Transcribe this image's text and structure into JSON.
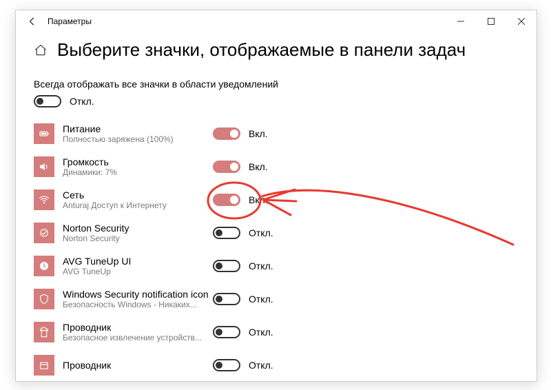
{
  "window": {
    "title": "Параметры"
  },
  "page": {
    "title": "Выберите значки, отображаемые в панели задач",
    "subline": "Всегда отображать все значки в области уведомлений"
  },
  "master_toggle": {
    "on": false,
    "state_label": "Откл."
  },
  "labels": {
    "on": "Вкл.",
    "off": "Откл."
  },
  "items": [
    {
      "name": "Питание",
      "sub": "Полностью заряжена (100%)",
      "on": true
    },
    {
      "name": "Громкость",
      "sub": "Динамики: 7%",
      "on": true
    },
    {
      "name": "Сеть",
      "sub": "Anturaj Доступ к Интернету",
      "on": true
    },
    {
      "name": "Norton Security",
      "sub": "Norton Security",
      "on": false
    },
    {
      "name": "AVG TuneUp UI",
      "sub": "AVG TuneUp",
      "on": false
    },
    {
      "name": "Windows Security notification icon",
      "sub": "Безопасность Windows - Никаких...",
      "on": false
    },
    {
      "name": "Проводник",
      "sub": "Безопасное извлечение устройств...",
      "on": false
    },
    {
      "name": "Проводник",
      "sub": "",
      "on": false
    }
  ],
  "colors": {
    "accent": "#d47d7c",
    "annotation": "#e83a2f"
  }
}
